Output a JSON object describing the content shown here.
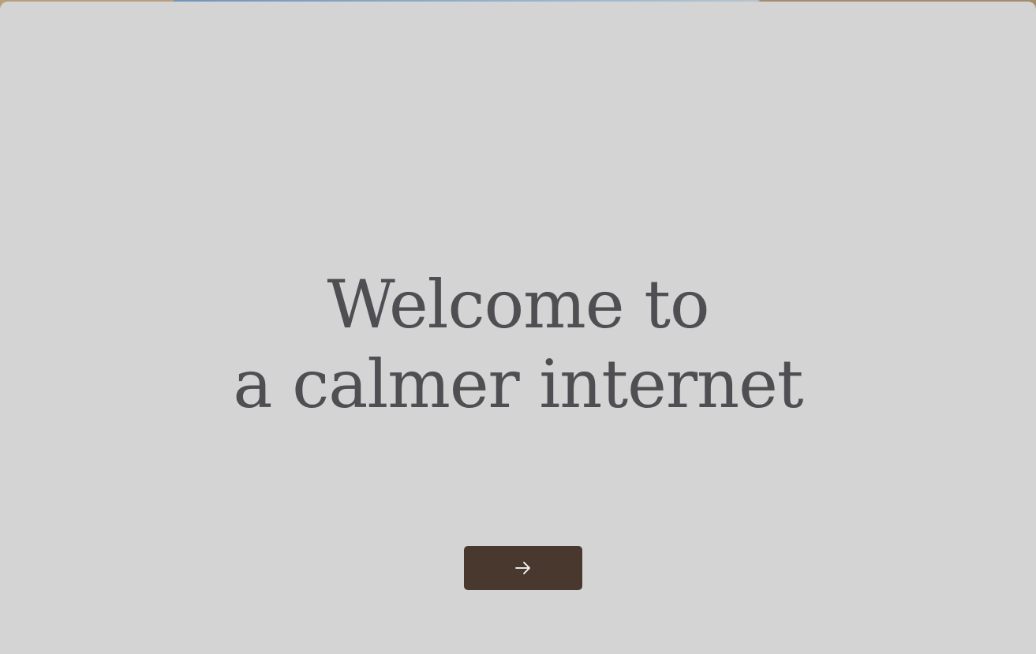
{
  "welcome": {
    "headline_line_1": "Welcome to",
    "headline_line_2": "a calmer internet"
  },
  "continue_button": {
    "icon": "arrow-right-icon",
    "aria_label": "Continue"
  },
  "colors": {
    "panel_background": "#d4d4d4",
    "headline_text": "#4f4f53",
    "button_background": "#48382e",
    "button_icon": "#ffffff"
  }
}
